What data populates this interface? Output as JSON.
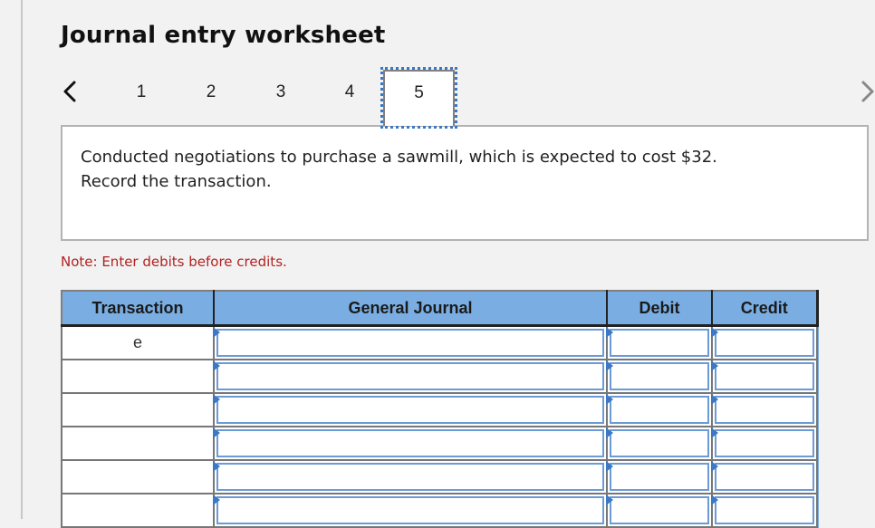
{
  "header": {
    "title": "Journal entry worksheet"
  },
  "stepper": {
    "prev_icon": "chevron-left-icon",
    "next_icon": "chevron-right-icon",
    "steps": [
      "1",
      "2",
      "3",
      "4",
      "5"
    ],
    "active_step": "5"
  },
  "prompt": {
    "line1": "Conducted negotiations to purchase a sawmill, which is expected to cost $32.",
    "line2": "Record the transaction."
  },
  "note": "Note: Enter debits before credits.",
  "journal": {
    "headers": {
      "transaction": "Transaction",
      "general_journal": "General Journal",
      "debit": "Debit",
      "credit": "Credit"
    },
    "rows": [
      {
        "transaction": "e",
        "general_journal": "",
        "debit": "",
        "credit": ""
      },
      {
        "transaction": "",
        "general_journal": "",
        "debit": "",
        "credit": ""
      },
      {
        "transaction": "",
        "general_journal": "",
        "debit": "",
        "credit": ""
      },
      {
        "transaction": "",
        "general_journal": "",
        "debit": "",
        "credit": ""
      },
      {
        "transaction": "",
        "general_journal": "",
        "debit": "",
        "credit": ""
      },
      {
        "transaction": "",
        "general_journal": "",
        "debit": "",
        "credit": ""
      }
    ]
  },
  "colors": {
    "header_bg": "#7aaee3",
    "note_red": "#b22222",
    "focus_blue": "#3a78c3"
  }
}
